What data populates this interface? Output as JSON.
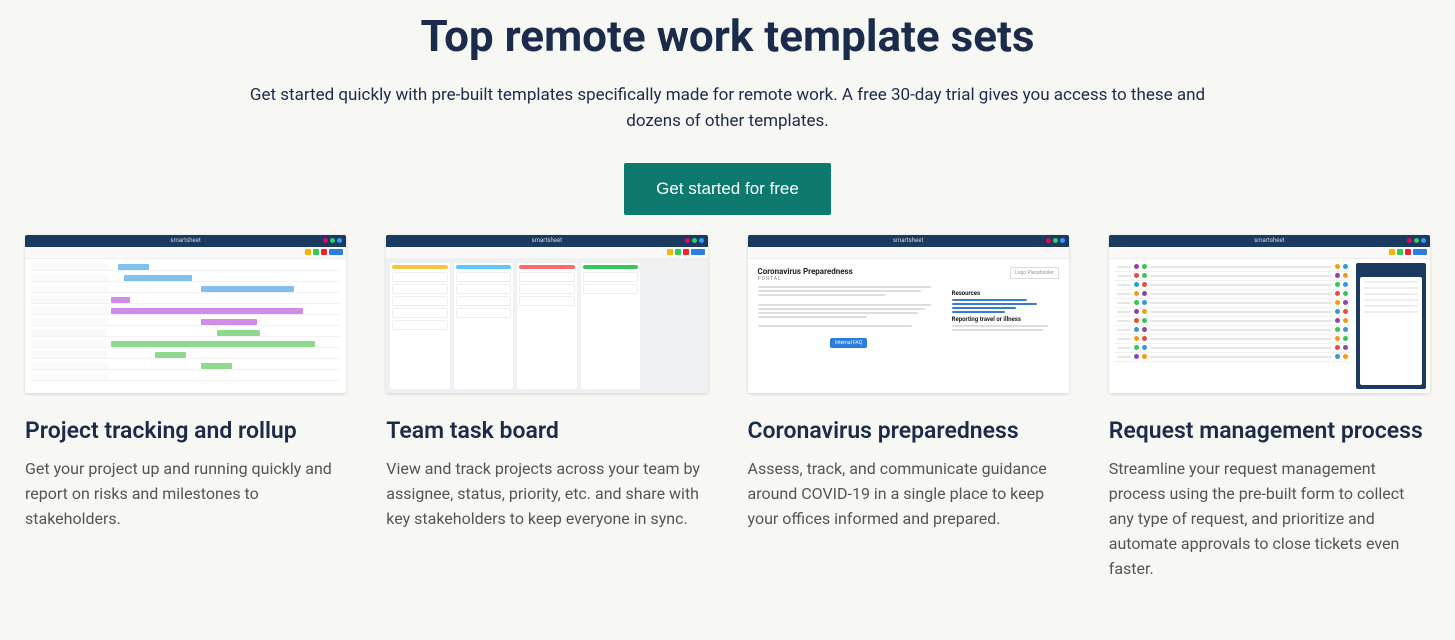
{
  "hero": {
    "title": "Top remote work template sets",
    "subtitle": "Get started quickly with pre-built templates specifically made for remote work. A free 30-day trial gives you access to these and dozens of other templates.",
    "cta_label": "Get started for free"
  },
  "thumb_brand": "smartsheet",
  "cards": [
    {
      "title": "Project tracking and rollup",
      "desc": "Get your project up and running quickly and report on risks and milestones to stakeholders."
    },
    {
      "title": "Team task board",
      "desc": "View and track projects across your team by assignee, status, priority, etc. and share with key stakeholders to keep everyone in sync."
    },
    {
      "title": "Coronavirus preparedness",
      "desc": "Assess, track, and communicate guidance around COVID-19 in a single place to keep your offices informed and prepared."
    },
    {
      "title": "Request management process",
      "desc": "Streamline your request management process using the pre-built form to collect any type of request, and prioritize and automate approvals to close tickets even faster."
    }
  ],
  "portal": {
    "title": "Coronavirus Preparedness",
    "subtitle": "PORTAL",
    "button": "Internal FAQ",
    "logo_placeholder": "Logo Placeholder",
    "resources_heading": "Resources",
    "reporting_heading": "Reporting travel or illness"
  }
}
